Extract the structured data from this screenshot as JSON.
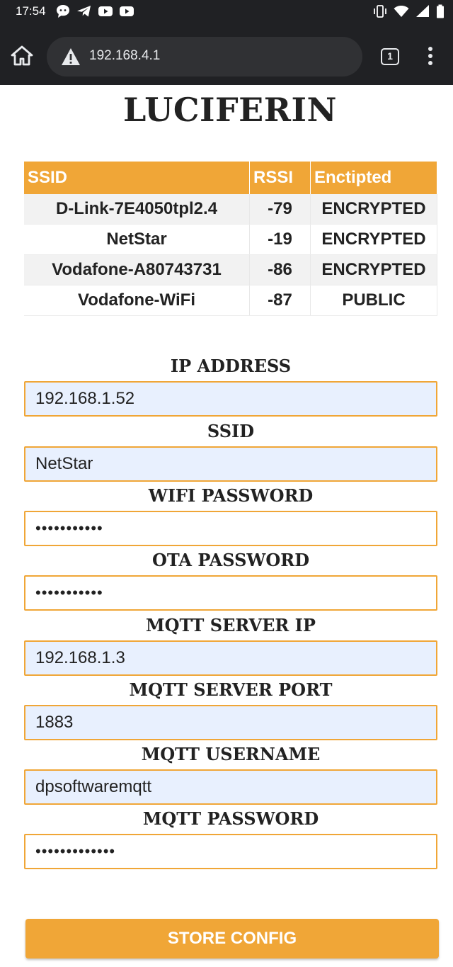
{
  "status_bar": {
    "time": "17:54",
    "left_icons": [
      "chat-bubble-icon",
      "telegram-icon",
      "youtube-icon",
      "youtube-icon"
    ],
    "right_icons": [
      "vibrate-icon",
      "wifi-icon",
      "signal-icon",
      "battery-icon"
    ]
  },
  "browser": {
    "url": "192.168.4.1",
    "tab_count": "1",
    "security_icon": "warning-icon"
  },
  "page": {
    "title": "LUCIFERIN",
    "accent_color": "#f0a637",
    "networks_table": {
      "headers": [
        "SSID",
        "RSSI",
        "Enctipted"
      ],
      "rows": [
        {
          "ssid": "D-Link-7E4050tpl2.4",
          "rssi": "-79",
          "security": "ENCRYPTED"
        },
        {
          "ssid": "NetStar",
          "rssi": "-19",
          "security": "ENCRYPTED"
        },
        {
          "ssid": "Vodafone-A80743731",
          "rssi": "-86",
          "security": "ENCRYPTED"
        },
        {
          "ssid": "Vodafone-WiFi",
          "rssi": "-87",
          "security": "PUBLIC"
        }
      ]
    },
    "form": {
      "ip_address": {
        "label": "IP ADDRESS",
        "value": "192.168.1.52"
      },
      "ssid": {
        "label": "SSID",
        "value": "NetStar"
      },
      "wifi_password": {
        "label": "WIFI PASSWORD",
        "value": "•••••••••••"
      },
      "ota_password": {
        "label": "OTA PASSWORD",
        "value": "•••••••••••"
      },
      "mqtt_server_ip": {
        "label": "MQTT SERVER IP",
        "value": "192.168.1.3"
      },
      "mqtt_server_port": {
        "label": "MQTT SERVER PORT",
        "value": "1883"
      },
      "mqtt_username": {
        "label": "MQTT USERNAME",
        "value": "dpsoftwaremqtt"
      },
      "mqtt_password": {
        "label": "MQTT PASSWORD",
        "value": "•••••••••••••"
      }
    },
    "submit_label": "STORE CONFIG"
  }
}
